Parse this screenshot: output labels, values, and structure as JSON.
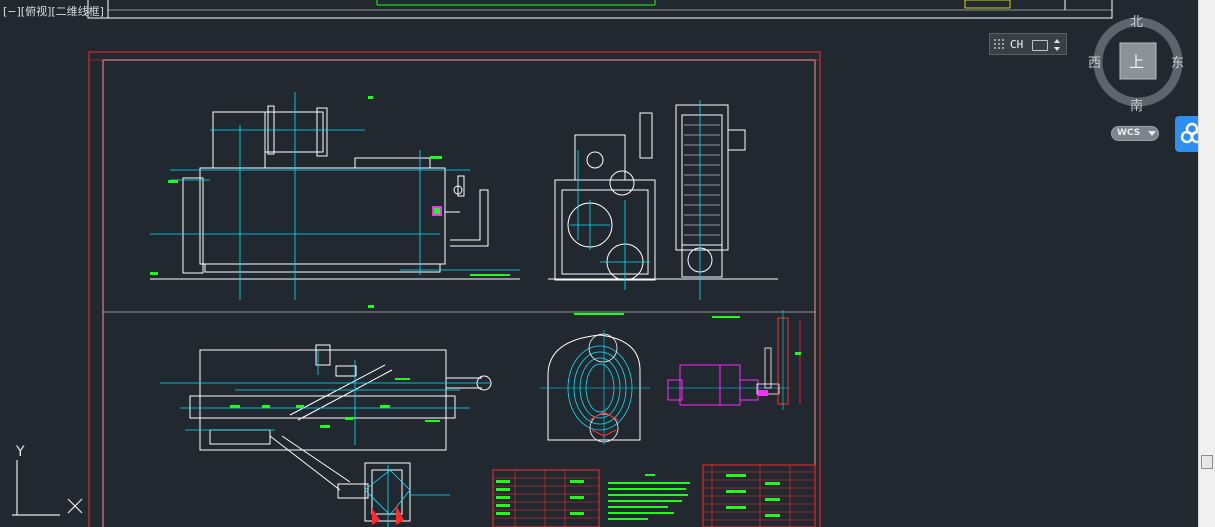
{
  "viewport": {
    "label": "[−][俯视][二维线框]",
    "background": "#212830"
  },
  "ime": {
    "language": "CH"
  },
  "viewcube": {
    "north": "北",
    "south": "南",
    "east": "东",
    "west": "西",
    "face": "上"
  },
  "wcs": {
    "label": "WCS"
  },
  "baidu": {
    "icon": "baidu-cloud-icon",
    "color": "#2e8ff0"
  },
  "ucs": {
    "y_label": "Y"
  },
  "colors": {
    "frame_red": "#ff2a2a",
    "line_white": "#ffffff",
    "line_cyan": "#00e5ff",
    "line_green": "#19ff19",
    "line_magenta": "#ff2aff",
    "line_yellow": "#ffff00"
  }
}
